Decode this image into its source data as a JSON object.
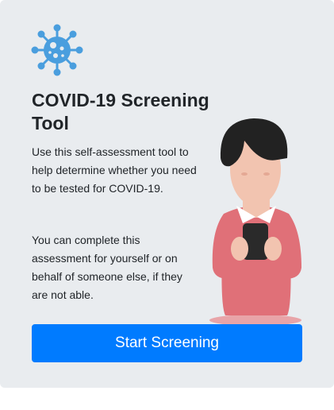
{
  "card": {
    "title": "COVID-19 Screening Tool",
    "description_1": "Use this self-assessment tool to help determine whether you need to be tested for COVID-19.",
    "description_2": "You can complete this assessment for yourself or on behalf of someone else, if they are not able.",
    "start_button_label": "Start Screening"
  },
  "icons": {
    "header_icon": "virus-icon",
    "illustration": "person-holding-phone-illustration"
  },
  "colors": {
    "card_background": "#e9ecef",
    "primary_button": "#007bff",
    "virus_icon": "#4a9ede",
    "sweater": "#e07078",
    "hair": "#222222",
    "skin": "#f2c4b0"
  }
}
